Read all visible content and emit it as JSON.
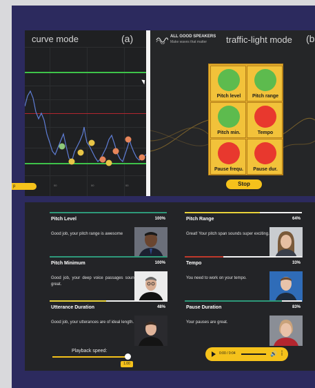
{
  "curve_mode": {
    "title": "curve mode",
    "label": "(a)",
    "ticks": [
      "00",
      "00",
      "00"
    ],
    "colors": {
      "green": "#3ec34a",
      "red": "#b3262f",
      "curve": "#5f7ed6"
    },
    "dots": [
      {
        "color": "#8fc87a"
      },
      {
        "color": "#e8c547"
      },
      {
        "color": "#e8c547"
      },
      {
        "color": "#e8c547"
      },
      {
        "color": "#e6855a"
      },
      {
        "color": "#e8c547"
      },
      {
        "color": "#e6855a"
      },
      {
        "color": "#e6855a"
      },
      {
        "color": "#e6855a"
      }
    ]
  },
  "left_button": {
    "label": "p"
  },
  "traffic_mode": {
    "logo_line1": "ALL GOOD SPEAKERS",
    "logo_line2": "Make waves that matter",
    "title": "traffic-light mode",
    "label": "(b",
    "cells": [
      {
        "label": "Pitch level",
        "color": "#5dbb4e"
      },
      {
        "label": "Pitch range",
        "color": "#5dbb4e"
      },
      {
        "label": "Pitch min.",
        "color": "#5dbb4e"
      },
      {
        "label": "Tempo",
        "color": "#e8382e"
      },
      {
        "label": "Pause frequ.",
        "color": "#e8382e"
      },
      {
        "label": "Pause dur.",
        "color": "#e8382e"
      }
    ],
    "stop_label": "Stop"
  },
  "metrics": [
    {
      "title": "Pitch Level",
      "value": "100%",
      "fill": 1.0,
      "color": "#2e9a7a",
      "text": "Good job, your pitch range is awesome",
      "portrait": "portrait-obama"
    },
    {
      "title": "Pitch Range",
      "value": "64%",
      "fill": 0.64,
      "color": "#e9d33a",
      "text": "Great! Your pitch span sounds super exciting.",
      "portrait": "portrait-thunberg"
    },
    {
      "title": "Pitch Minimum",
      "value": "100%",
      "fill": 1.0,
      "color": "#2e9a7a",
      "text": "Good job, your deep voice passages sound great.",
      "portrait": "portrait-jobs"
    },
    {
      "title": "Tempo",
      "value": "33%",
      "fill": 0.33,
      "color": "#c0392b",
      "text": "You need to work on your tempo.",
      "portrait": "portrait-zuckerberg"
    },
    {
      "title": "Utterance Duration",
      "value": "48%",
      "fill": 0.48,
      "color": "#e9d33a",
      "text": "Good job, your utterances are of ideal length.",
      "portrait": "portrait-musk"
    },
    {
      "title": "Pause Duration",
      "value": "83%",
      "fill": 0.83,
      "color": "#2e9a7a",
      "text": "Your pauses are great.",
      "portrait": "portrait-merkel"
    }
  ],
  "playback": {
    "label": "Playback speed:",
    "value": "1.00",
    "level": 0.95
  },
  "player": {
    "time": "0:00 / 0:04",
    "play_icon": "play-icon",
    "volume_icon": "volume-icon",
    "more_icon": "more-icon"
  }
}
